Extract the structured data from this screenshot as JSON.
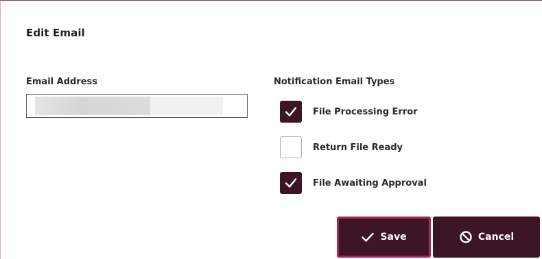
{
  "dialog": {
    "title": "Edit Email"
  },
  "email": {
    "label": "Email Address",
    "value": "",
    "placeholder": ""
  },
  "notifications": {
    "label": "Notification Email Types",
    "options": [
      {
        "label": "File Processing Error",
        "checked": true
      },
      {
        "label": "Return File Ready",
        "checked": false
      },
      {
        "label": "File Awaiting Approval",
        "checked": true
      }
    ]
  },
  "actions": {
    "save_label": "Save",
    "save_icon": "checkmark-icon",
    "cancel_label": "Cancel",
    "cancel_icon": "prohibited-icon"
  },
  "colors": {
    "accent": "#3d1626",
    "focus_border": "#b22356",
    "dialog_border": "#8b2f5a"
  }
}
